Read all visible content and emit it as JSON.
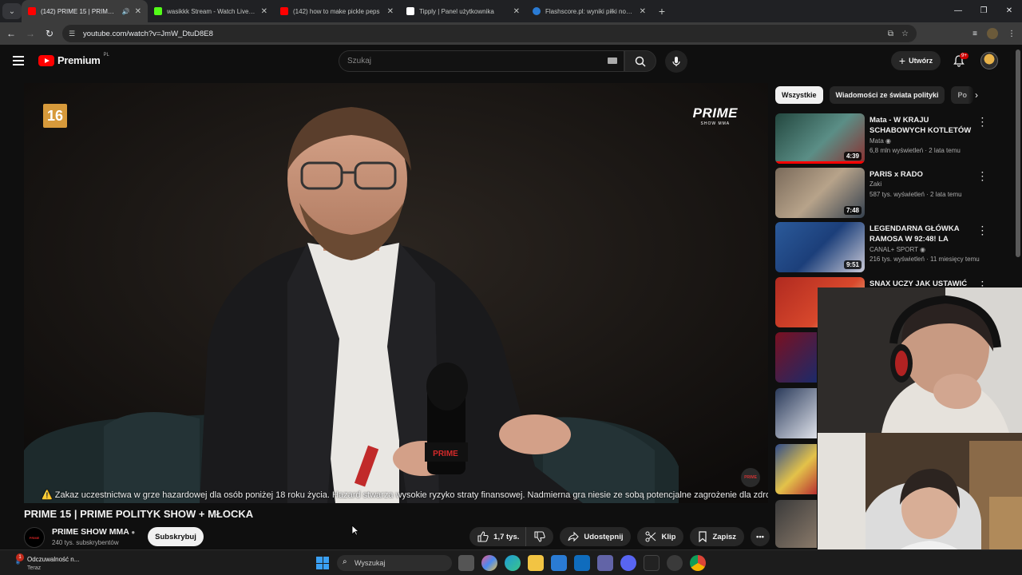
{
  "browser": {
    "tabs": [
      {
        "title": "(142) PRIME 15 | PRIME PO",
        "active": true,
        "fav_color": "#ff0000",
        "icon": "youtube-icon",
        "audio": true
      },
      {
        "title": "wasikkk Stream - Watch Live on",
        "active": false,
        "fav_color": "#53fc18",
        "icon": "kick-icon"
      },
      {
        "title": "(142) how to make pickle peps",
        "active": false,
        "fav_color": "#ff0000",
        "icon": "youtube-icon"
      },
      {
        "title": "Tipply | Panel użytkownika",
        "active": false,
        "fav_color": "#ffffff",
        "icon": "tipply-icon"
      },
      {
        "title": "Flashscore.pl: wyniki piłki nożne",
        "active": false,
        "fav_color": "#2a7bd4",
        "icon": "flashscore-icon"
      }
    ],
    "url": "youtube.com/watch?v=JmW_DtuD8E8"
  },
  "yt": {
    "logo_text": "Premium",
    "logo_sup": "PL",
    "search_placeholder": "Szukaj",
    "create_label": "Utwórz",
    "notif_badge": "9+"
  },
  "video": {
    "age_rating": "16",
    "watermark_big": "PRIME",
    "watermark_small": "SHOW MMA",
    "warning_text": "⚠️ Zakaz uczestnictwa w grze hazardowej dla osób poniżej 18 roku życia. Hazard stwarza wysokie ryzyko straty finansowej. Nadmierna gra niesie ze sobą potencjalne zagrożenie dla zdrowia ⚠️",
    "title": "PRIME 15 | PRIME POLITYK SHOW + MŁOCKA",
    "channel_name": "PRIME SHOW MMA",
    "subscribers": "240 tys. subskrybentów",
    "subscribe_label": "Subskrybuj",
    "likes": "1,7 tys.",
    "share_label": "Udostępnij",
    "clip_label": "Klip",
    "save_label": "Zapisz"
  },
  "sidebar": {
    "chips": [
      "Wszystkie",
      "Wiadomości ze świata polityki",
      "Po"
    ],
    "recs": [
      {
        "title": "Mata - W KRAJU SCHABOWYCH KOTLETÓW",
        "channel": "Mata",
        "verified": true,
        "meta": "6,8 mln wyświetleń · 2 lata temu",
        "duration": "4:39",
        "thumb": "#2a5a54"
      },
      {
        "title": "PARIS x RADO",
        "channel": "Zaki",
        "verified": false,
        "meta": "587 tys. wyświetleń · 2 lata temu",
        "duration": "7:48",
        "thumb": "#6a5a4a"
      },
      {
        "title": "LEGENDARNA GŁÓWKA RAMOSA W 92:48! LA DECIMA...",
        "channel": "CANAL+ SPORT",
        "verified": true,
        "meta": "216 tys. wyświetleń · 11 miesięcy temu",
        "duration": "9:51",
        "thumb": "#1c3f7a"
      },
      {
        "title": "SNAX UCZY JAK USTAWIĆ CS2",
        "channel": "",
        "verified": false,
        "meta": "",
        "duration": "",
        "thumb": "#b02a20"
      }
    ]
  },
  "taskbar": {
    "notification_title": "Odczuwalność n...",
    "notification_sub": "Teraz",
    "notification_count": "1",
    "search_placeholder": "Wyszukaj"
  }
}
